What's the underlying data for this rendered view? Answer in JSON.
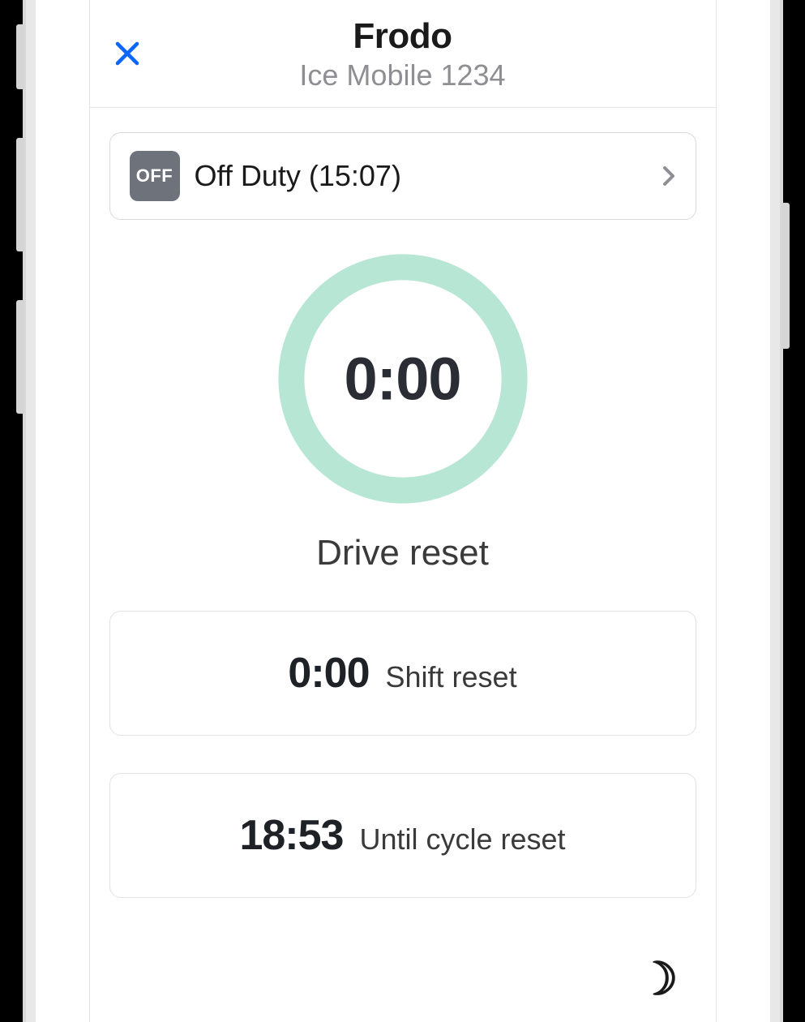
{
  "header": {
    "title": "Frodo",
    "subtitle": "Ice Mobile 1234"
  },
  "status": {
    "badge": "OFF",
    "text": "Off Duty (15:07)"
  },
  "gauge": {
    "value": "0:00",
    "label": "Drive reset",
    "ring_color": "#b8e6d4"
  },
  "cards": [
    {
      "time": "0:00",
      "label": "Shift reset"
    },
    {
      "time": "18:53",
      "label": "Until cycle reset"
    }
  ],
  "icons": {
    "moon": "☽"
  }
}
